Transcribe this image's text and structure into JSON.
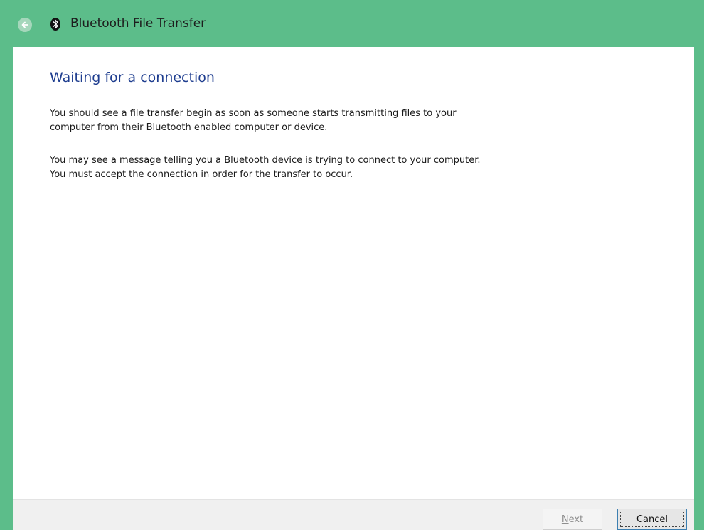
{
  "window": {
    "title": "Bluetooth File Transfer",
    "accent_color": "#5cbd8a",
    "icons": {
      "back": "back-arrow-icon",
      "app": "bluetooth-icon"
    }
  },
  "main": {
    "heading": "Waiting for a connection",
    "heading_color": "#1e3d8f",
    "paragraph_1": [
      "You should see a file transfer begin as soon as someone starts transmitting files to your",
      "computer from their Bluetooth enabled computer or device."
    ],
    "paragraph_2": [
      "You may see a message telling you a Bluetooth device is trying to connect to your computer.",
      "You must accept the connection in order for the transfer to occur."
    ]
  },
  "footer": {
    "next_label_accel": "N",
    "next_label_rest": "ext",
    "cancel_label": "Cancel"
  }
}
